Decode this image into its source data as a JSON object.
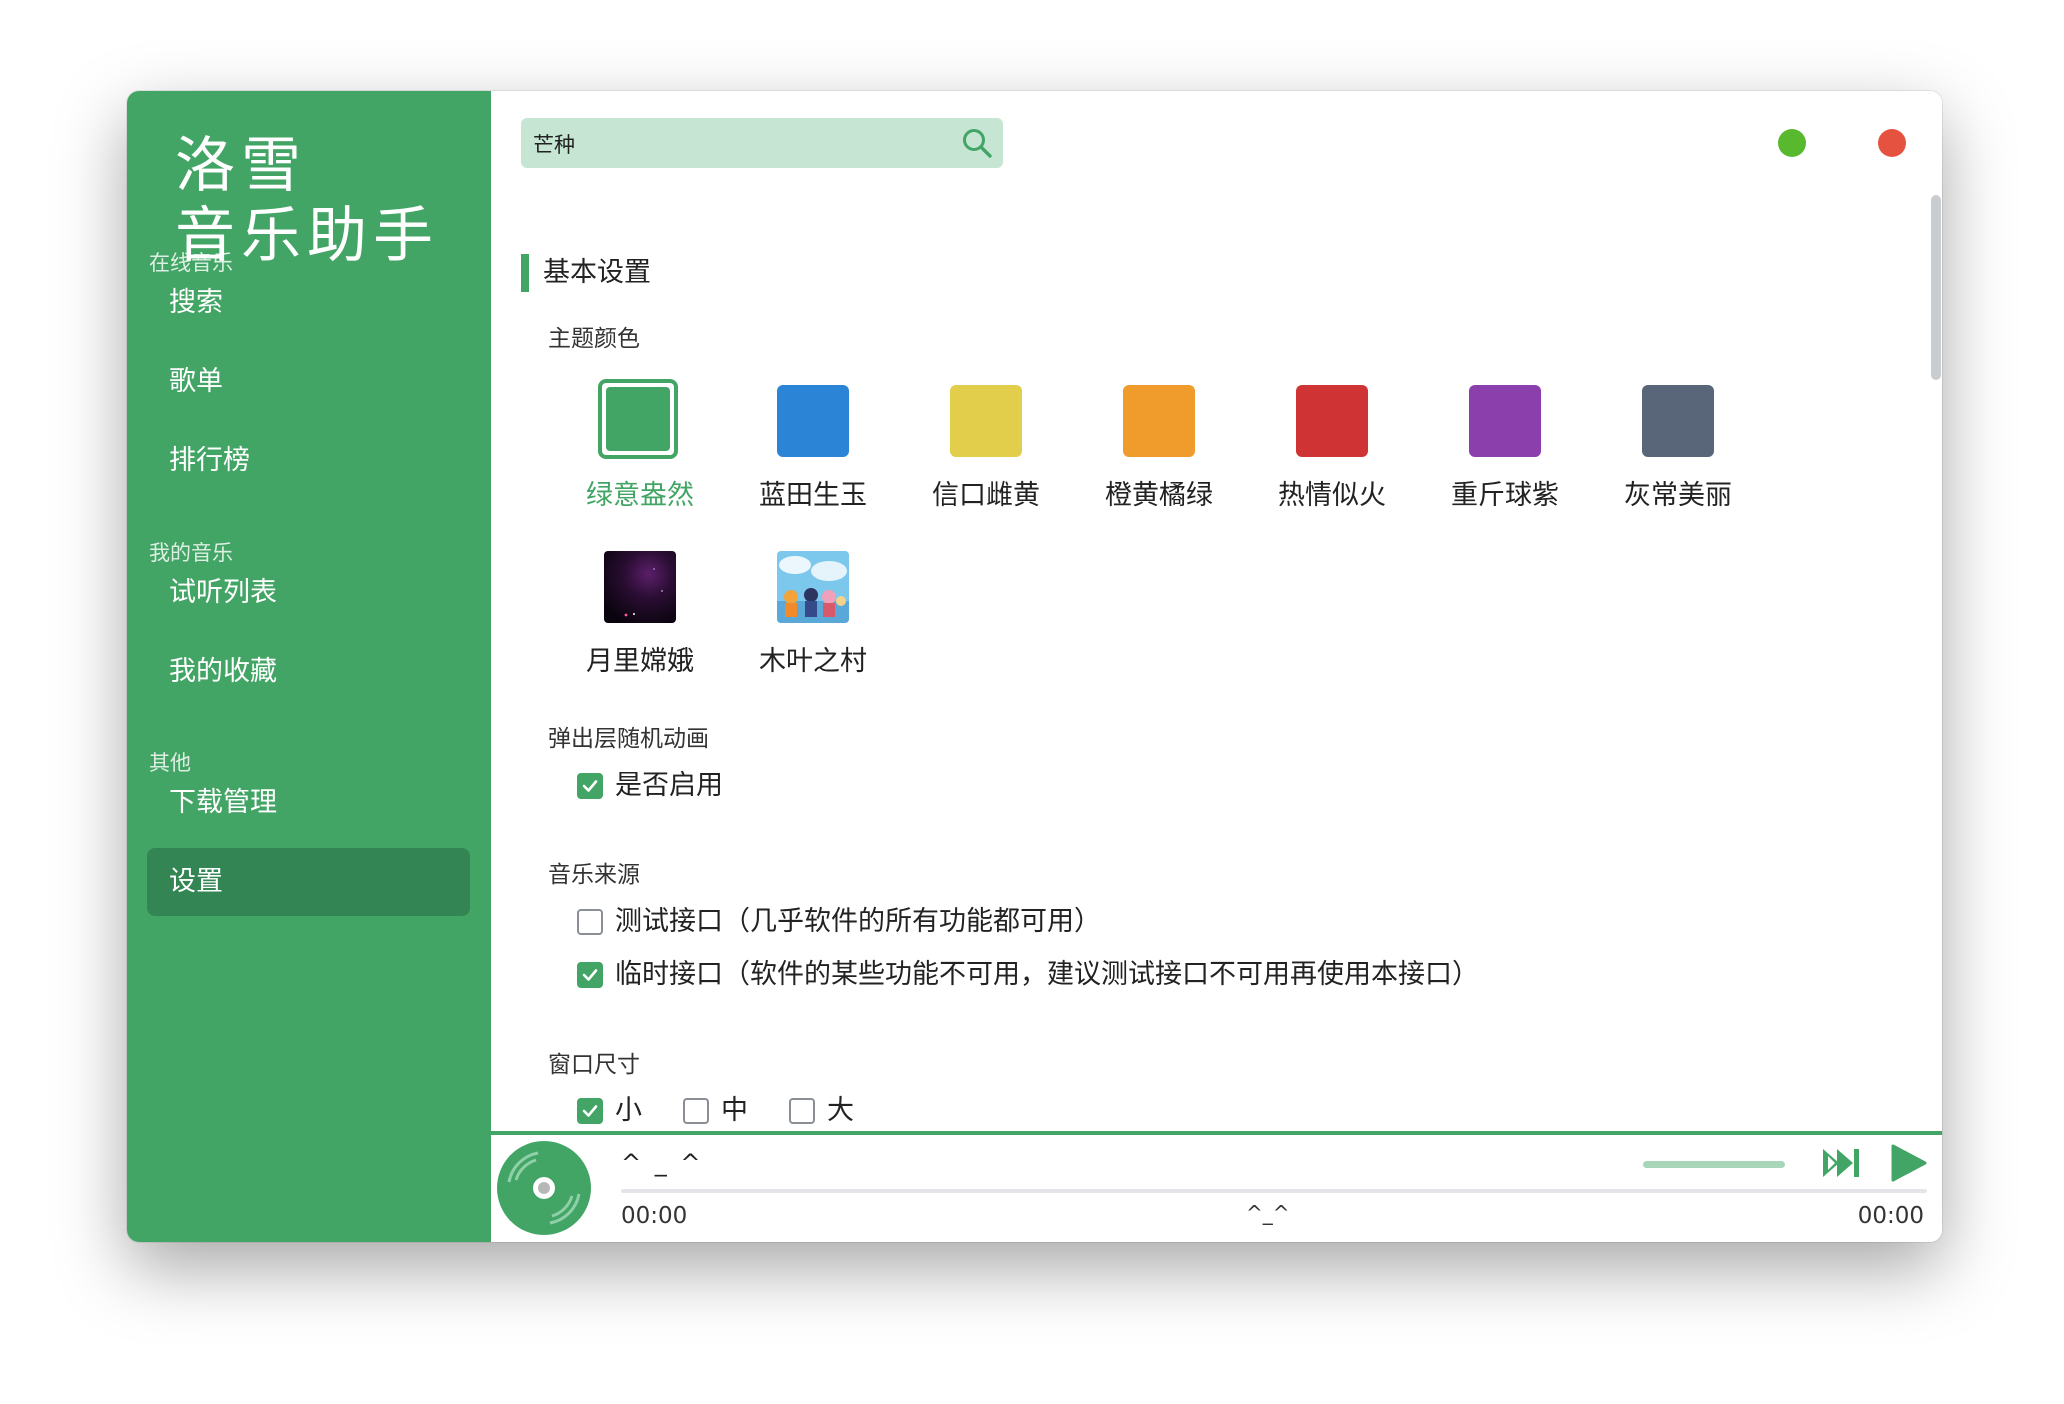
{
  "app": {
    "logo_line1": "洛雪",
    "logo_line2": "音乐助手"
  },
  "sidebar": {
    "groups": [
      {
        "title": "在线音乐",
        "items": [
          {
            "label": "搜索"
          },
          {
            "label": "歌单"
          },
          {
            "label": "排行榜"
          }
        ]
      },
      {
        "title": "我的音乐",
        "items": [
          {
            "label": "试听列表"
          },
          {
            "label": "我的收藏"
          }
        ]
      },
      {
        "title": "其他",
        "items": [
          {
            "label": "下载管理"
          },
          {
            "label": "设置",
            "active": true
          }
        ]
      }
    ]
  },
  "search": {
    "value": "芒种"
  },
  "settings": {
    "section_title": "基本设置",
    "theme": {
      "title": "主题颜色",
      "options": [
        {
          "label": "绿意盎然",
          "color": "#43a565",
          "selected": true
        },
        {
          "label": "蓝田生玉",
          "color": "#2b84d6"
        },
        {
          "label": "信口雌黄",
          "color": "#e2ce4a"
        },
        {
          "label": "橙黄橘绿",
          "color": "#f09c2d"
        },
        {
          "label": "热情似火",
          "color": "#d03334"
        },
        {
          "label": "重斤球紫",
          "color": "#8a3fac"
        },
        {
          "label": "灰常美丽",
          "color": "#596679"
        },
        {
          "label": "月里嫦娥",
          "icon": "night-sky-image"
        },
        {
          "label": "木叶之村",
          "icon": "anime-characters-image"
        }
      ]
    },
    "animation": {
      "title": "弹出层随机动画",
      "enable_label": "是否启用",
      "enabled": true
    },
    "source": {
      "title": "音乐来源",
      "options": [
        {
          "label": "测试接口（几乎软件的所有功能都可用）",
          "checked": false
        },
        {
          "label": "临时接口（软件的某些功能不可用，建议测试接口不可用再使用本接口）",
          "checked": true
        }
      ]
    },
    "window_size": {
      "title": "窗口尺寸",
      "options": [
        {
          "label": "小",
          "checked": true
        },
        {
          "label": "中",
          "checked": false
        },
        {
          "label": "大",
          "checked": false
        }
      ]
    }
  },
  "player": {
    "title": "^ _ ^",
    "time_current": "00:00",
    "lyric": "^_^",
    "time_total": "00:00"
  },
  "colors": {
    "accent": "#43a565",
    "accent_dark": "#338654",
    "window_green": "#58b82e",
    "window_red": "#e55340"
  }
}
